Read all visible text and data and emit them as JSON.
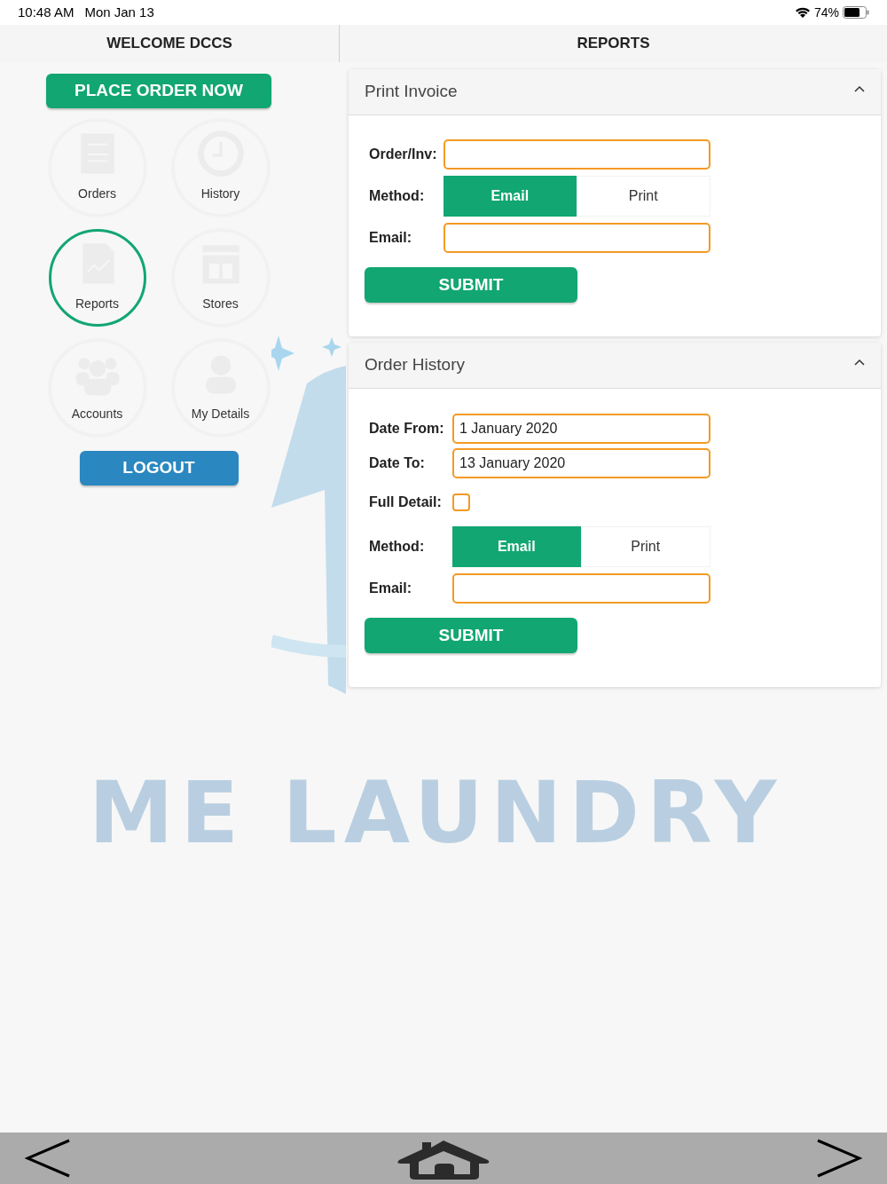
{
  "status_bar": {
    "time": "10:48 AM",
    "date": "Mon Jan 13",
    "battery": "74%"
  },
  "header": {
    "left_title": "WELCOME DCCS",
    "right_title": "REPORTS"
  },
  "sidebar": {
    "place_order_button": "PLACE ORDER NOW",
    "items": [
      {
        "label": "Orders",
        "kind": "orders",
        "selected": false
      },
      {
        "label": "History",
        "kind": "history",
        "selected": false
      },
      {
        "label": "Reports",
        "kind": "reports",
        "selected": true
      },
      {
        "label": "Stores",
        "kind": "stores",
        "selected": false
      },
      {
        "label": "Accounts",
        "kind": "accounts",
        "selected": false
      },
      {
        "label": "My Details",
        "kind": "person",
        "selected": false
      }
    ],
    "logout_button": "LOGOUT"
  },
  "background": {
    "logo_text": "ME LAUNDRY"
  },
  "panels": [
    {
      "title": "Print Invoice",
      "expanded": true,
      "fields": [
        {
          "kind": "input",
          "label": "Order/Inv:"
        },
        {
          "kind": "segmented",
          "label": "Method:",
          "options": [
            {
              "label": "Email",
              "selected": true
            },
            {
              "label": "Print",
              "selected": false
            }
          ]
        },
        {
          "kind": "input",
          "label": "Email:"
        }
      ],
      "submit": "SUBMIT"
    },
    {
      "title": "Order History",
      "expanded": true,
      "fields": [
        {
          "kind": "input",
          "label": "Date From:",
          "value": "1 January 2020"
        },
        {
          "kind": "input",
          "label": "Date To:",
          "value": "13 January 2020"
        },
        {
          "kind": "checkbox",
          "label": "Full Detail:",
          "checked": false
        },
        {
          "kind": "segmented",
          "label": "Method:",
          "options": [
            {
              "label": "Email",
              "selected": true
            },
            {
              "label": "Print",
              "selected": false
            }
          ]
        },
        {
          "kind": "input",
          "label": "Email:"
        }
      ],
      "submit": "SUBMIT"
    }
  ]
}
